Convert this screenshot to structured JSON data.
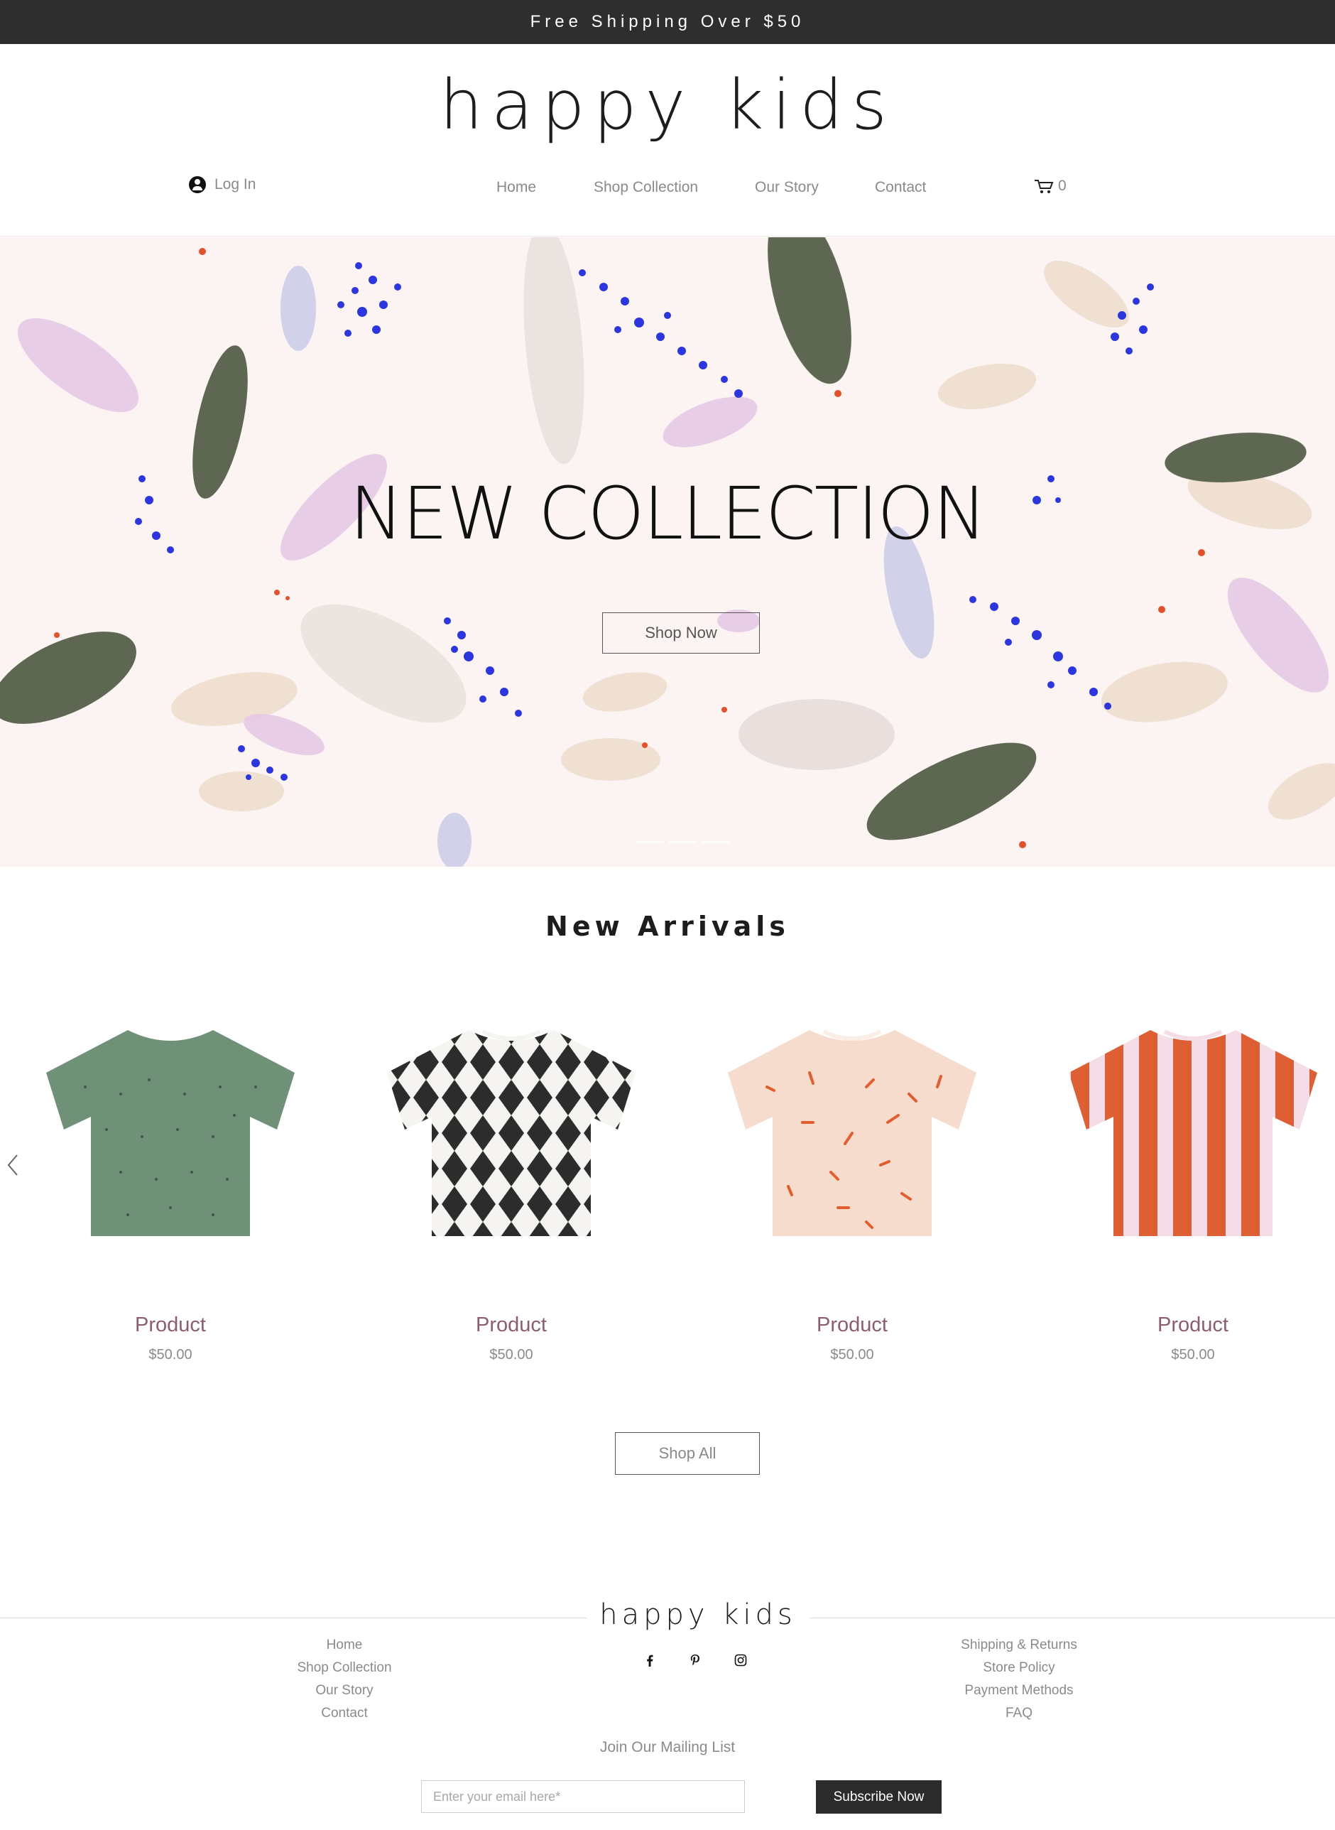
{
  "announcement": {
    "text": "Free Shipping Over $50"
  },
  "header": {
    "logo": "happy kids",
    "login_label": "Log In",
    "nav": [
      "Home",
      "Shop Collection",
      "Our Story",
      "Contact"
    ],
    "cart_count": "0"
  },
  "hero": {
    "title": "NEW COLLECTION",
    "button_label": "Shop Now",
    "slide_indicators": 3
  },
  "arrivals": {
    "title": "New Arrivals",
    "products": [
      {
        "name": "Product",
        "price": "$50.00",
        "pattern": "green-sprinkle-tee"
      },
      {
        "name": "Product",
        "price": "$50.00",
        "pattern": "black-diamond-tee"
      },
      {
        "name": "Product",
        "price": "$50.00",
        "pattern": "peach-confetti-tee"
      },
      {
        "name": "Product",
        "price": "$50.00",
        "pattern": "orange-stripe-tee"
      }
    ],
    "shop_all_label": "Shop All"
  },
  "footer": {
    "logo": "happy kids",
    "links_left": [
      "Home",
      "Shop Collection",
      "Our Story",
      "Contact"
    ],
    "links_right": [
      "Shipping & Returns",
      "Store Policy",
      "Payment Methods",
      "FAQ"
    ],
    "social": [
      "facebook-icon",
      "pinterest-icon",
      "instagram-icon"
    ],
    "mailing_title": "Join Our Mailing List",
    "email_placeholder": "Enter your email here*",
    "subscribe_label": "Subscribe Now"
  },
  "colors": {
    "topbar": "#2e2e2e",
    "hero_bg": "#fbf4f2",
    "product_name": "#8c5d6a",
    "button_dark": "#2b2b2b"
  }
}
